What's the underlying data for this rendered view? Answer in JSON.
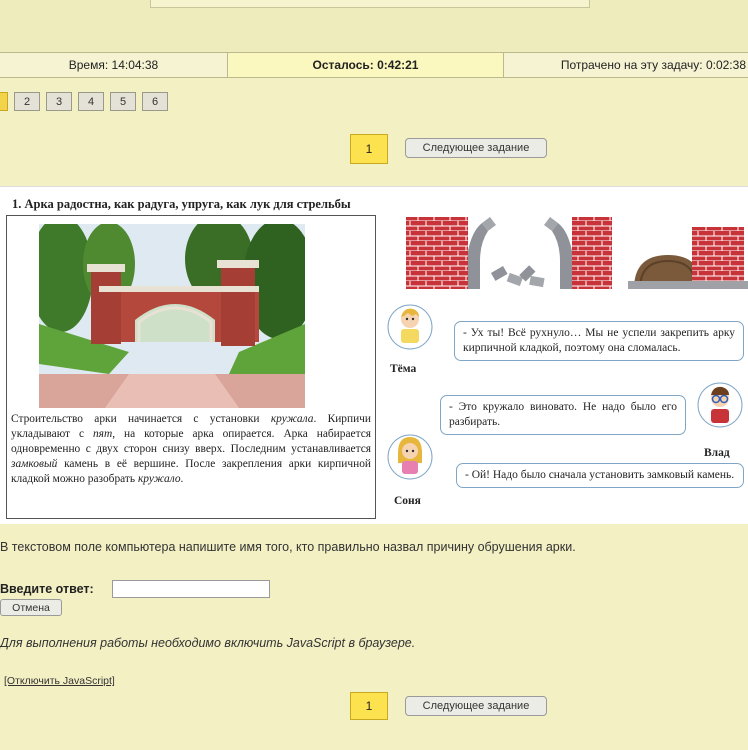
{
  "status": {
    "time": "Время: 14:04:38",
    "remaining": "Осталось: 0:42:21",
    "spent": "Потрачено на эту задачу: 0:02:38"
  },
  "tabs": [
    "2",
    "3",
    "4",
    "5",
    "6"
  ],
  "nav": {
    "current": "1",
    "next_label": "Следующее задание"
  },
  "task": {
    "title": "1. Арка радостна, как радуга, упруга, как лук для стрельбы",
    "text_parts": [
      {
        "t": "Строительство арки начинается с установки ",
        "i": false
      },
      {
        "t": "кружала",
        "i": true
      },
      {
        "t": ". Кирпичи укладывают с ",
        "i": false
      },
      {
        "t": "пят",
        "i": true
      },
      {
        "t": ", на которые арка опирается. Арка набирается одновременно с двух сторон снизу вверх. Последним устанавливается ",
        "i": false
      },
      {
        "t": "замковый",
        "i": true
      },
      {
        "t": " камень в её вершине. После закрепления арки кирпичной кладкой можно разобрать ",
        "i": false
      },
      {
        "t": "кружало",
        "i": true
      },
      {
        "t": ".",
        "i": false
      }
    ],
    "characters": {
      "tema": {
        "name": "Тёма",
        "speech": "- Ух ты! Всё рухнуло… Мы не успели закрепить арку кирпичной кладкой, поэтому она сломалась."
      },
      "vlad": {
        "name": "Влад",
        "speech": "- Это кружало виновато. Не надо было его разбирать."
      },
      "sonya": {
        "name": "Соня",
        "speech": "- Ой! Надо было сначала установить замковый камень."
      }
    }
  },
  "question": "В текстовом поле компьютера напишите имя того, кто правильно назвал причину обрушения арки.",
  "answer": {
    "label": "Введите ответ:",
    "value": "",
    "cancel_label": "Отмена"
  },
  "js_note": "Для выполнения работы необходимо включить JavaScript в браузере.",
  "js_link": "[Отключить JavaScript]",
  "colors": {
    "background": "#f3f0c4",
    "current_task": "#fde24f",
    "bubble_border": "#7fa6c6",
    "brick": "#c8333a"
  }
}
